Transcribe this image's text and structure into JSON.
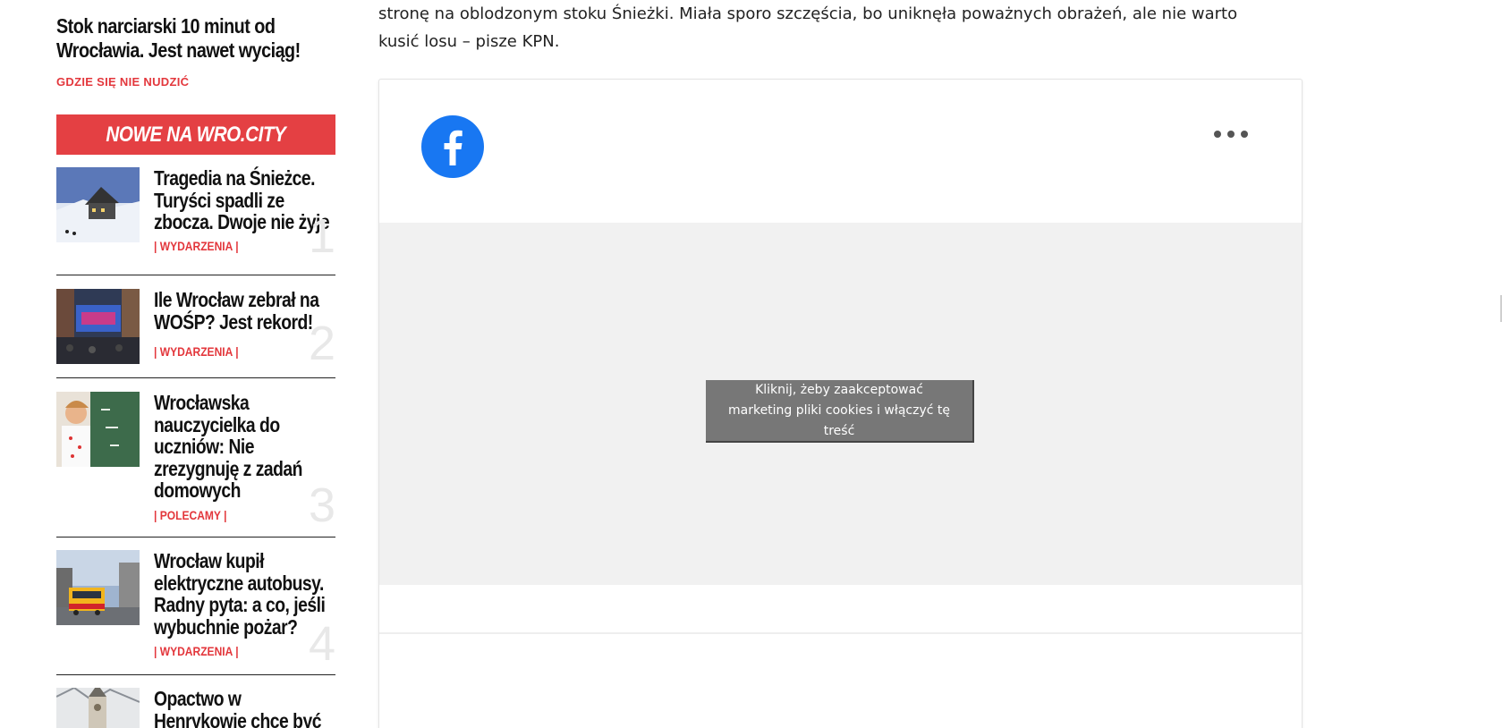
{
  "sidebar": {
    "top_article": {
      "title": "Stok narciarski 10 minut od Wrocławia. Jest nawet wyciąg!",
      "category": "GDZIE SIĘ NIE NUDZIĆ"
    },
    "section_title": "NOWE NA WRO.CITY",
    "items": [
      {
        "title": "Tragedia na Śnieżce. Turyści spadli ze zbocza. Dwoje nie żyje",
        "category": "| WYDARZENIA |",
        "rank": "1"
      },
      {
        "title": "Ile Wrocław zebrał na WOŚP? Jest rekord!",
        "category": "| WYDARZENIA |",
        "rank": "2"
      },
      {
        "title": "Wrocławska nauczycielka do uczniów: Nie zrezygnuję z zadań domowych",
        "category": "| POLECAMY |",
        "rank": "3"
      },
      {
        "title": "Wrocław kupił elektryczne autobusy. Radny pyta: a co, jeśli wybuchnie pożar?",
        "category": "| WYDARZENIA |",
        "rank": "4"
      },
      {
        "title": "Opactwo w Henrykowie chce być",
        "category": "",
        "rank": ""
      }
    ]
  },
  "article": {
    "text": "stronę na oblodzonym stoku Śnieżki. Miała sporo szczęścia, bo uniknęła poważnych obrażeń, ale nie warto kusić losu – pisze KPN."
  },
  "embed": {
    "logo_icon": "facebook-icon",
    "more_icon": "more-options-icon",
    "consent_label": "Kliknij, żeby zaakceptować marketing pliki cookies i włączyć tę treść"
  },
  "colors": {
    "accent": "#e44043",
    "facebook_blue": "#1877f2",
    "placeholder_bg": "#f1f1f1"
  }
}
